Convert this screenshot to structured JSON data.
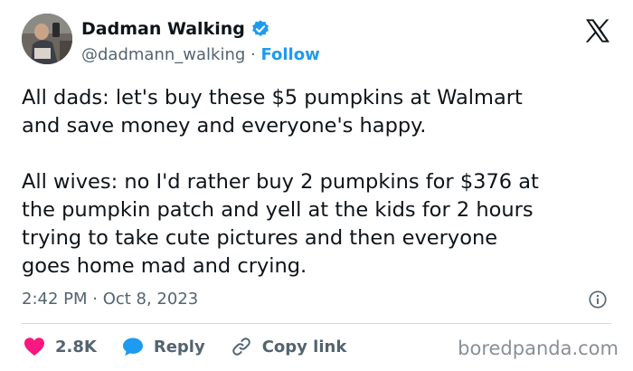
{
  "author": {
    "display_name": "Dadman Walking",
    "handle": "@dadmann_walking",
    "separator": " · ",
    "follow_label": "Follow",
    "avatar_icon": "avatar-photo",
    "verified_icon": "verified-badge-icon"
  },
  "brand": {
    "logo_icon": "x-logo-icon"
  },
  "tweet": {
    "paragraph_1": "All dads: let's buy these $5 pumpkins at Walmart\nand save money and everyone's happy.",
    "paragraph_2": "All wives: no I'd rather buy 2 pumpkins for $376 at\nthe pumpkin patch and yell at the kids for 2 hours\ntrying to take cute pictures and then everyone\ngoes home mad and crying.",
    "timestamp": "2:42 PM · Oct 8, 2023",
    "info_icon": "info-icon"
  },
  "actions": {
    "like_count": "2.8K",
    "reply_label": "Reply",
    "copy_label": "Copy link"
  },
  "watermark": "boredpanda.com",
  "colors": {
    "accent": "#1d9bf0",
    "like": "#f91880",
    "secondary_text": "#536471",
    "primary_text": "#0f1419"
  }
}
